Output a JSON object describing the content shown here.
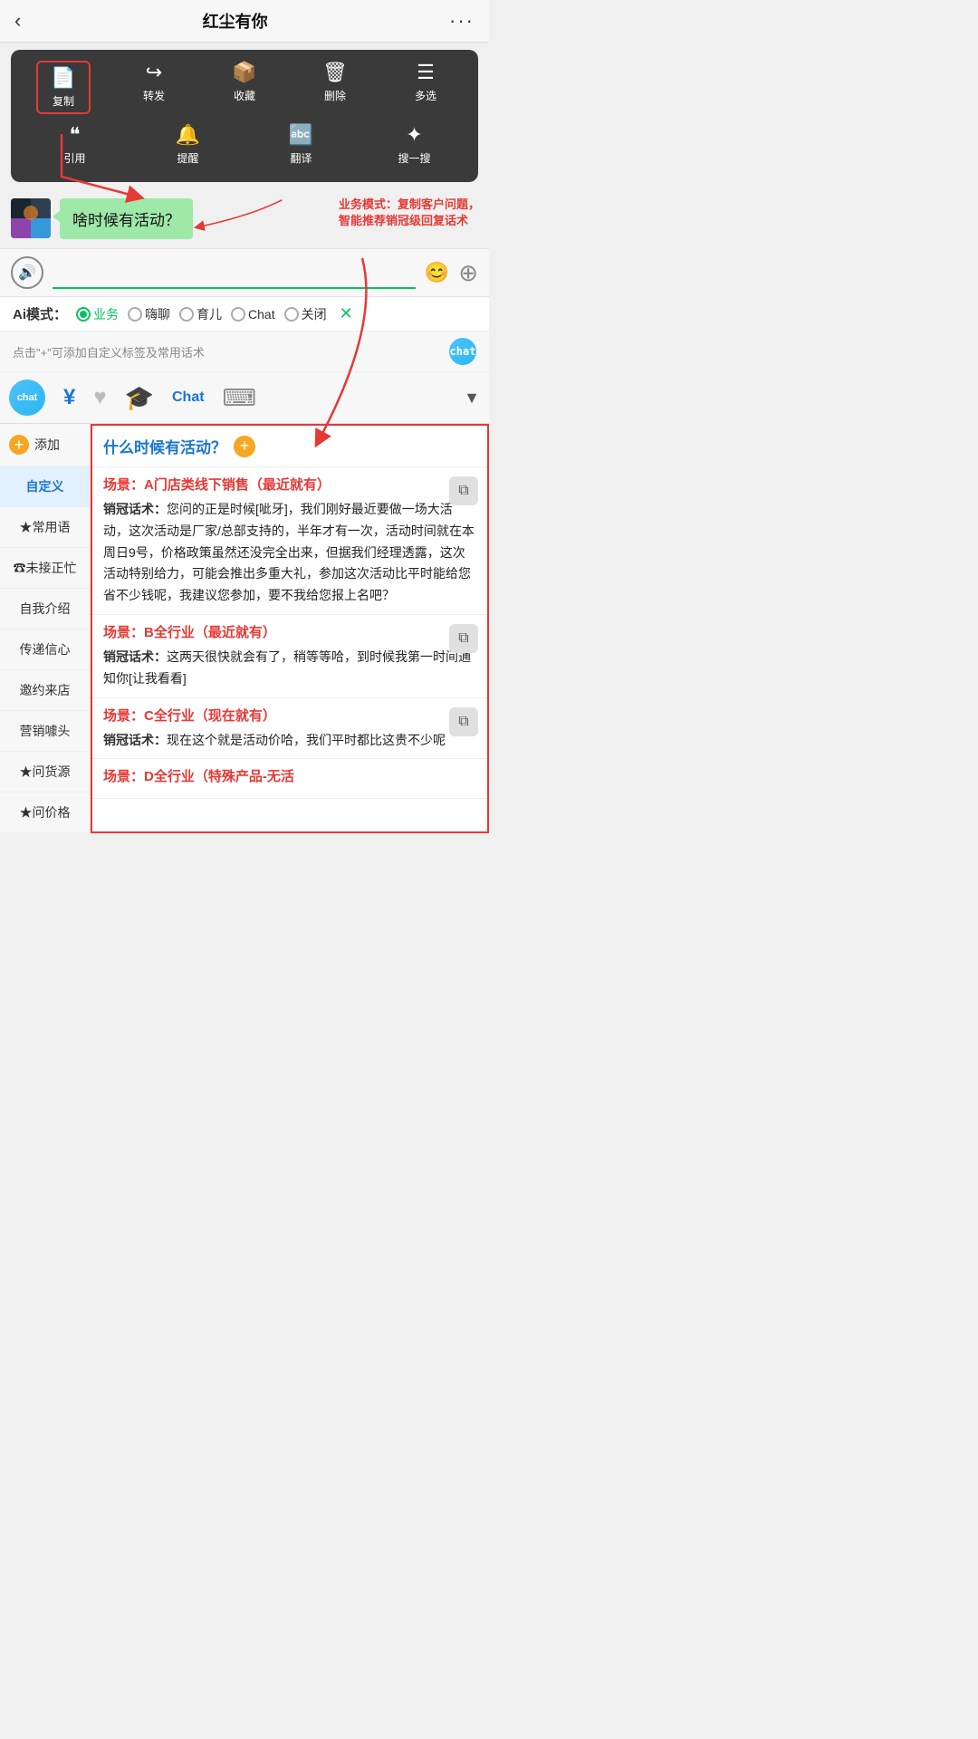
{
  "header": {
    "back_icon": "‹",
    "title": "红尘有你",
    "more_icon": "···"
  },
  "context_menu": {
    "row1": [
      {
        "icon": "📄",
        "label": "复制",
        "highlighted": true
      },
      {
        "icon": "↪",
        "label": "转发",
        "highlighted": false
      },
      {
        "icon": "📦",
        "label": "收藏",
        "highlighted": false
      },
      {
        "icon": "🗑",
        "label": "删除",
        "highlighted": false
      },
      {
        "icon": "≡",
        "label": "多选",
        "highlighted": false
      }
    ],
    "row2": [
      {
        "icon": "❝",
        "label": "引用",
        "highlighted": false
      },
      {
        "icon": "🔔",
        "label": "提醒",
        "highlighted": false
      },
      {
        "icon": "🔤",
        "label": "翻译",
        "highlighted": false
      },
      {
        "icon": "✦",
        "label": "搜一搜",
        "highlighted": false
      }
    ]
  },
  "chat": {
    "bubble_text": "啥时候有活动？",
    "annotation": "业务模式：复制客户问题，\n智能推荐销冠级回复话术"
  },
  "input_bar": {
    "placeholder": "",
    "voice_icon": "🔊",
    "emoji_icon": "😊",
    "plus_icon": "+"
  },
  "ai_mode": {
    "label": "Ai模式：",
    "options": [
      {
        "text": "业务",
        "active": true
      },
      {
        "text": "嗨聊",
        "active": false
      },
      {
        "text": "育儿",
        "active": false
      },
      {
        "text": "Chat",
        "active": false
      },
      {
        "text": "关闭",
        "active": false
      }
    ],
    "close_icon": "✕"
  },
  "hint_bar": {
    "text": "点击\"+\"可添加自定义标签及常用话术"
  },
  "toolbar": {
    "items": [
      {
        "icon": "chat",
        "label": "chat"
      },
      {
        "icon": "¥",
        "label": "yuan"
      },
      {
        "icon": "♥",
        "label": "heart"
      },
      {
        "icon": "🎓",
        "label": "grad"
      },
      {
        "icon": "Chat",
        "label": "chat-text"
      },
      {
        "icon": "⌨",
        "label": "keyboard"
      }
    ],
    "arrow": "▼"
  },
  "sidebar": {
    "add_label": "添加",
    "items": [
      {
        "label": "自定义",
        "active": true
      },
      {
        "label": "★常用语",
        "active": false
      },
      {
        "label": "☎未接正忙",
        "active": false
      },
      {
        "label": "自我介绍",
        "active": false
      },
      {
        "label": "传递信心",
        "active": false
      },
      {
        "label": "邀约来店",
        "active": false
      },
      {
        "label": "营销噱头",
        "active": false
      },
      {
        "label": "★问货源",
        "active": false
      },
      {
        "label": "★问价格",
        "active": false
      }
    ]
  },
  "right_content": {
    "question": "什么时候有活动？",
    "scenarios": [
      {
        "title": "场景：A门店类线下销售（最近就有）",
        "content_label": "销冠话术：",
        "content": "您问的正是时候[呲牙]，我们刚好最近要做一场大活动，这次活动是厂家/总部支持的，半年才有一次，活动时间就在本周日9号，价格政策虽然还没完全出来，但据我们经理透露，这次活动特别给力，可能会推出多重大礼，参加这次活动比平时能给您省不少钱呢，我建议您参加，要不我给您报上名吧？"
      },
      {
        "title": "场景：B全行业（最近就有）",
        "content_label": "销冠话术：",
        "content": "这两天很快就会有了，稍等等哈，到时候我第一时间通知你[让我看看]"
      },
      {
        "title": "场景：C全行业（现在就有）",
        "content_label": "销冠话术：",
        "content": "现在这个就是活动价哈，我们平时都比这贵不少呢"
      },
      {
        "title": "场景：D全行业（特殊产品-无活",
        "content_label": "",
        "content": ""
      }
    ]
  }
}
